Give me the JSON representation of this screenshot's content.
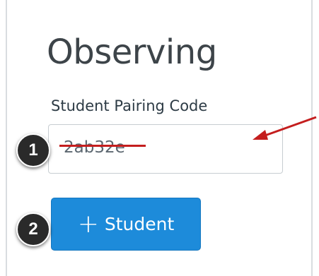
{
  "section": {
    "title": "Observing",
    "field_label": "Student Pairing Code"
  },
  "pairing_input": {
    "value": "2ab32e"
  },
  "add_button": {
    "icon": "plus-icon",
    "label": "Student"
  },
  "callouts": [
    "1",
    "2"
  ],
  "annotation_color": "#c41e1e"
}
